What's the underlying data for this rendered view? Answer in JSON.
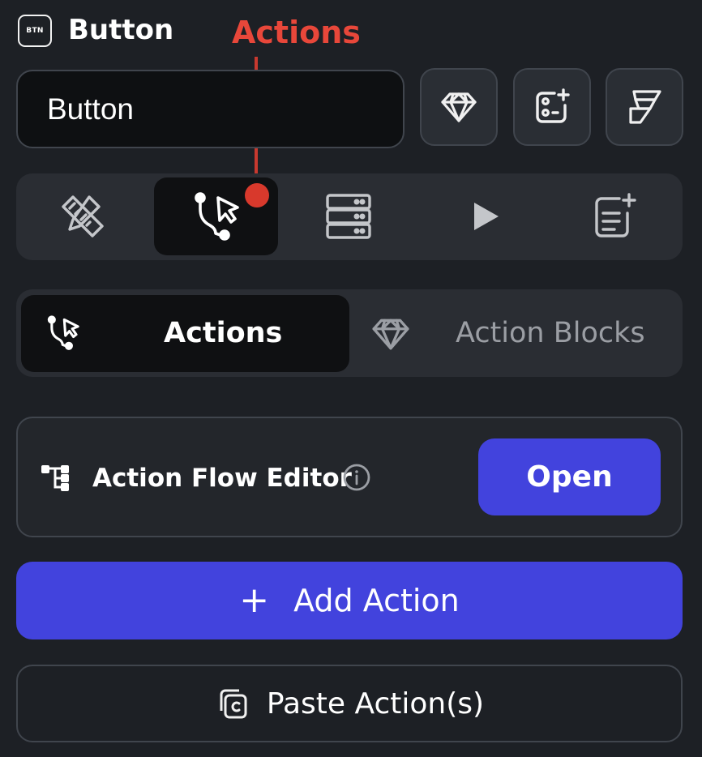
{
  "header": {
    "badge_text": "BTN",
    "widget_title": "Button",
    "annotation_label": "Actions"
  },
  "name_field": {
    "value": "Button"
  },
  "toolbar_icons": [
    "diamond-icon",
    "add-component-icon",
    "flutterflow-logo-icon"
  ],
  "tabs": [
    {
      "icon": "ruler-pencil-icon",
      "active": false
    },
    {
      "icon": "actions-icon",
      "active": true
    },
    {
      "icon": "backend-query-icon",
      "active": false
    },
    {
      "icon": "play-icon",
      "active": false
    },
    {
      "icon": "add-document-icon",
      "active": false
    }
  ],
  "segment": {
    "actions_label": "Actions",
    "action_blocks_label": "Action Blocks"
  },
  "flow_editor": {
    "title": "Action Flow Editor",
    "open_label": "Open"
  },
  "add_action": {
    "plus": "+",
    "label": "Add Action"
  },
  "paste_action": {
    "label": "Paste Action(s)"
  },
  "colors": {
    "background": "#1d2025",
    "accent": "#4243dd",
    "annotation": "#e8473a",
    "border": "#40454d"
  }
}
